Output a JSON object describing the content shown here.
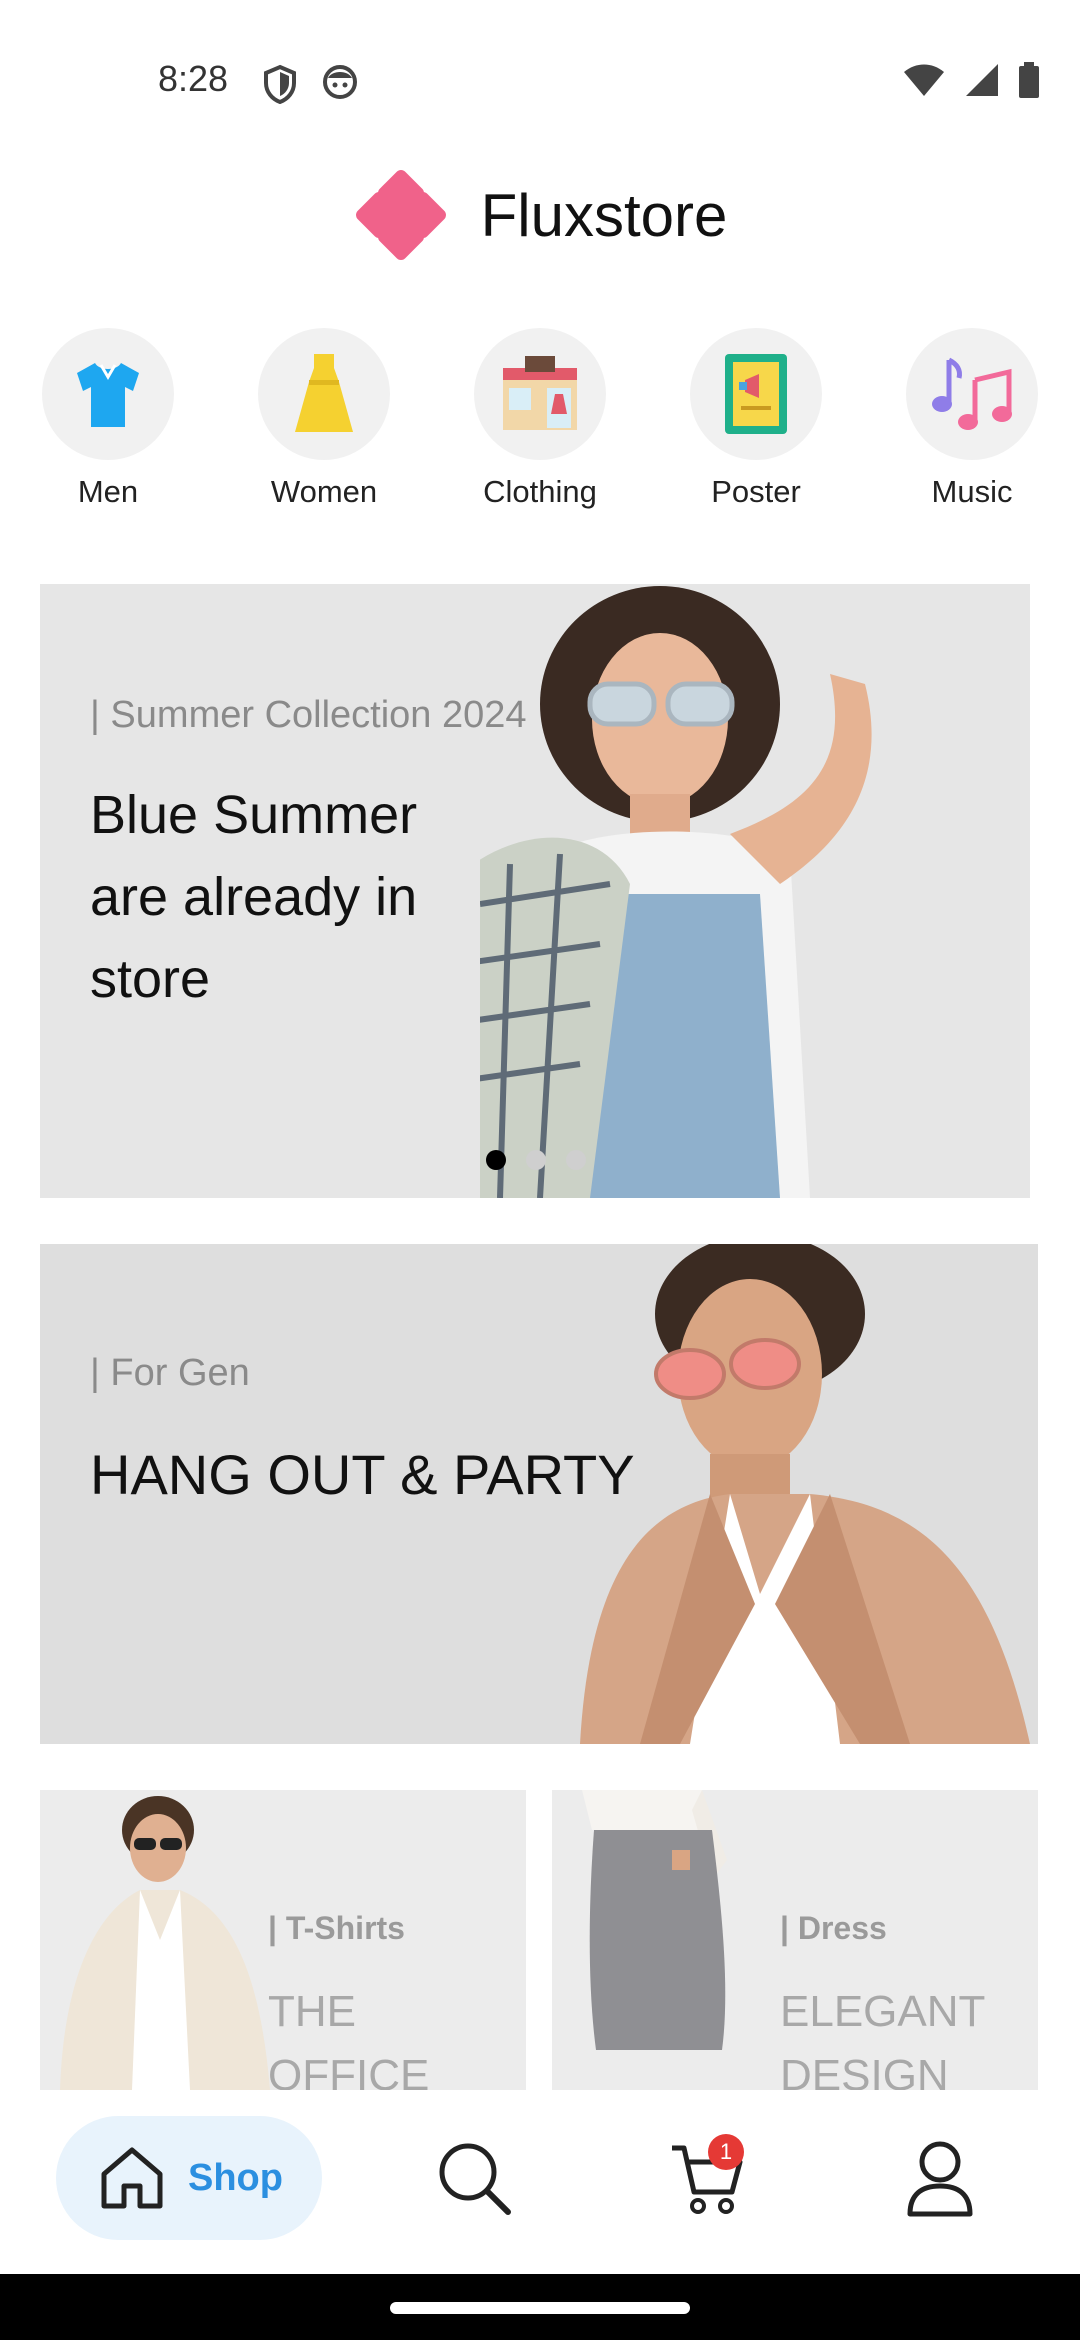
{
  "status_bar": {
    "time": "8:28"
  },
  "header": {
    "title": "Fluxstore",
    "logo_color": "#f0628a"
  },
  "categories": [
    {
      "label": "Men",
      "icon": "tshirt-icon"
    },
    {
      "label": "Women",
      "icon": "dress-icon"
    },
    {
      "label": "Clothing",
      "icon": "clothing-store-icon"
    },
    {
      "label": "Poster",
      "icon": "poster-icon"
    },
    {
      "label": "Music",
      "icon": "music-notes-icon"
    }
  ],
  "banner_1": {
    "tag": "| Summer Collection 2024",
    "headline": "Blue Summer are already in store",
    "active_slide": 1,
    "slide_count": 3
  },
  "banner_2": {
    "tag": "| For Gen",
    "headline": "HANG OUT & PARTY"
  },
  "tiles": [
    {
      "tag": "| T-Shirts",
      "headline": "THE OFFICE LIFE"
    },
    {
      "tag": "| Dress",
      "headline": "ELEGANT DESIGN"
    }
  ],
  "bottom_nav": {
    "shop_label": "Shop",
    "cart_count": "1",
    "accent": "#2b8fe0"
  }
}
